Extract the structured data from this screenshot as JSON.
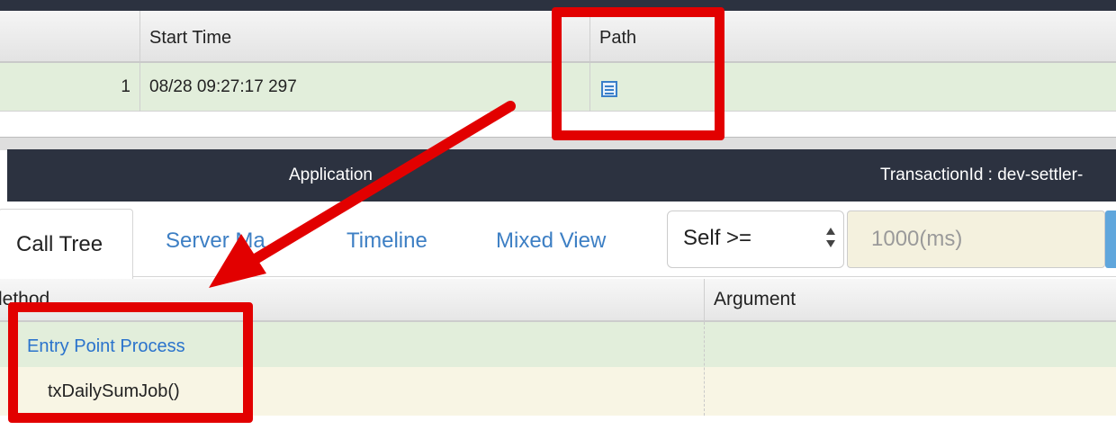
{
  "transaction_table": {
    "columns": {
      "start_time": "Start Time",
      "path": "Path"
    },
    "row": {
      "index": "1",
      "start_time": "08/28 09:27:17 297",
      "path_icon": "list-icon"
    }
  },
  "app_header": {
    "application_label": "Application",
    "transaction_id_label": "TransactionId : dev-settler-"
  },
  "tabs": {
    "call_tree": "Call Tree",
    "server_map": "Server Ma",
    "timeline": "Timeline",
    "mixed_view": "Mixed View"
  },
  "filter": {
    "select_value": "Self >=",
    "threshold_placeholder": "1000(ms)"
  },
  "call_tree": {
    "columns": {
      "method": "lethod",
      "argument": "Argument"
    },
    "rows": [
      {
        "method": "Entry Point Process"
      },
      {
        "method": "txDailySumJob()"
      }
    ]
  },
  "colors": {
    "annotation_red": "#e20000",
    "link_blue": "#3d7fc4",
    "header_dark": "#2c3240",
    "row_green": "#e2eedb",
    "row_yellow": "#f8f5e4"
  }
}
